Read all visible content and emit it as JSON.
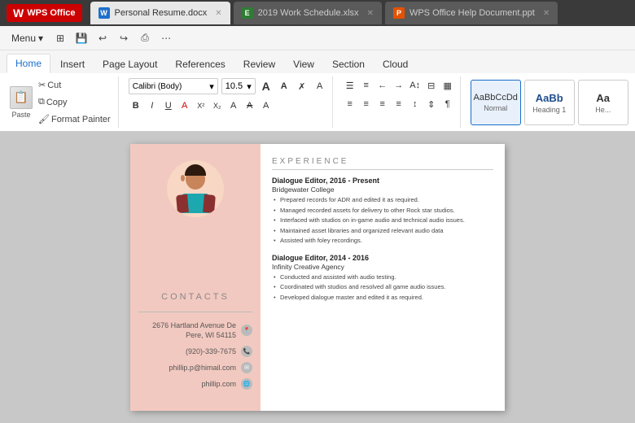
{
  "titleBar": {
    "wpsLabel": "WPS Office",
    "tabs": [
      {
        "id": "resume",
        "label": "Personal Resume.docx",
        "type": "word",
        "active": true
      },
      {
        "id": "schedule",
        "label": "2019 Work Schedule.xlsx",
        "type": "excel",
        "active": false
      },
      {
        "id": "help",
        "label": "WPS Office Help Document.ppt",
        "type": "ppt",
        "active": false
      }
    ]
  },
  "quickAccess": {
    "menuLabel": "Menu",
    "buttons": [
      "⊞",
      "💾",
      "↩",
      "↪",
      "🖨"
    ]
  },
  "ribbonTabs": [
    "Home",
    "Insert",
    "Page Layout",
    "References",
    "Review",
    "View",
    "Section",
    "Cloud"
  ],
  "activeRibbonTab": "Home",
  "ribbon": {
    "pasteLabel": "Paste",
    "cutLabel": "Cut",
    "copyLabel": "Copy",
    "formatPainterLabel": "Format Painter",
    "fontFamily": "Calibri (Body)",
    "fontSize": "10.5",
    "fontButtons": [
      "A",
      "A",
      "✗",
      "A"
    ],
    "formatButtons": [
      "B",
      "I",
      "U",
      "A",
      "X²",
      "X₂",
      "A",
      "A",
      "A"
    ],
    "alignButtons": [
      "≡",
      "≡",
      "≡",
      "≡",
      "≡"
    ],
    "paraButtons": [
      "¶",
      "↨",
      "↕",
      "⊟"
    ],
    "styles": [
      {
        "preview": "AaBbCcDd",
        "label": "Normal",
        "active": true
      },
      {
        "preview": "AaBb",
        "label": "Heading 1",
        "active": false
      },
      {
        "preview": "Aa",
        "label": "He...",
        "active": false
      }
    ]
  },
  "document": {
    "contacts": {
      "sectionLabel": "CONTACTS",
      "address": "2676 Hartland Avenue\nDe Pere, WI 54115",
      "phone": "(920)-339-7675",
      "email": "phillip.p@himail.com",
      "website": "phillip.com"
    },
    "experience": {
      "sectionLabel": "EXPERIENCE",
      "jobs": [
        {
          "title": "Dialogue Editor, 2016 - Present",
          "company": "Bridgewater College",
          "bullets": [
            "Prepared records for ADR and edited it as required.",
            "Managed recorded assets for delivery to other Rock star studios.",
            "Interfaced with studios on in-game audio and technical audio issues.",
            "Maintained asset libraries and organized relevant audio data",
            "Assisted with foley recordings."
          ]
        },
        {
          "title": "Dialogue Editor, 2014 - 2016",
          "company": "Infinity Creative Agency",
          "bullets": [
            "Conducted and assisted with audio testing.",
            "Coordinated with studios and resolved all game audio issues.",
            "Developed dialogue master and edited it as required."
          ]
        }
      ]
    }
  }
}
